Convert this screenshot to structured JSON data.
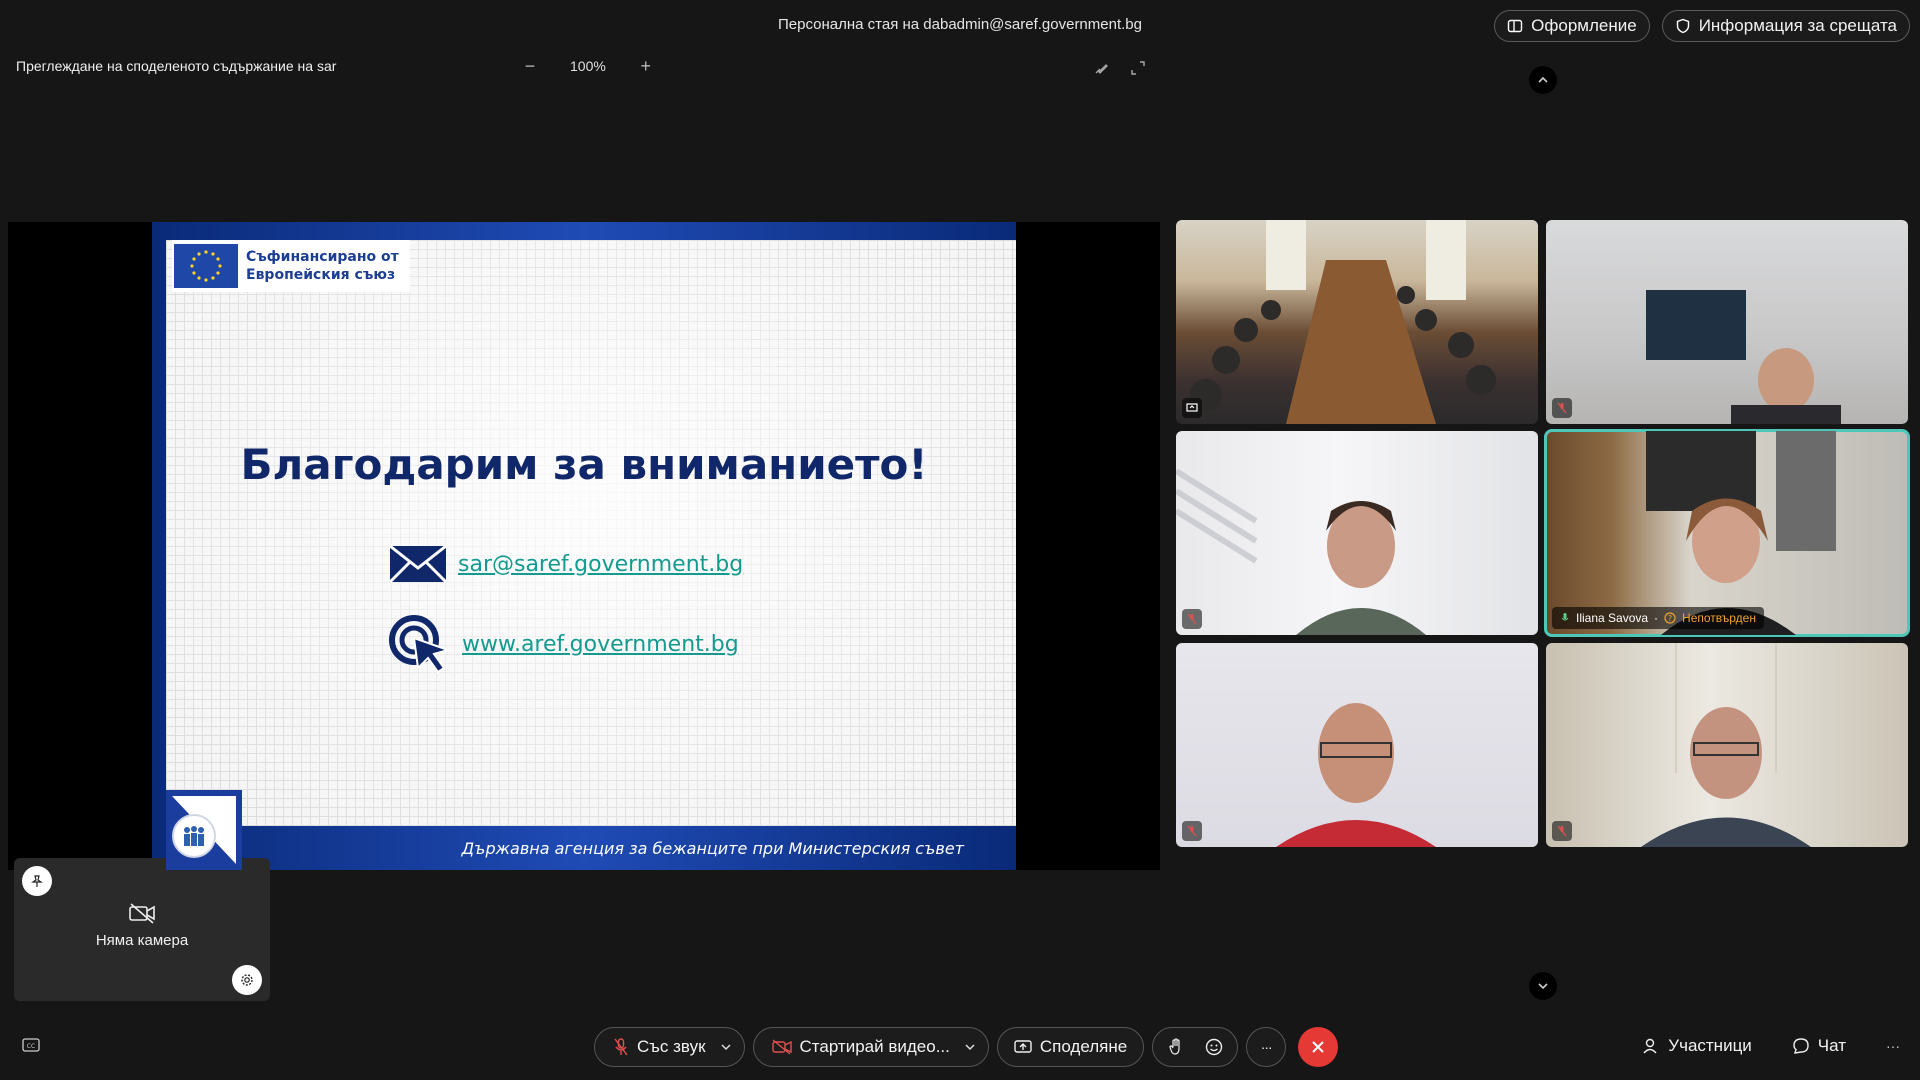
{
  "window": {
    "room_title": "Персонална стая на dabadmin@saref.government.bg"
  },
  "top_buttons": {
    "layout_label": "Оформление",
    "meeting_info_label": "Информация за срещата"
  },
  "share_bar": {
    "viewing_label": "Преглеждане на споделеното съдържание на sar",
    "zoom_level": "100%",
    "zoom_out_symbol": "−",
    "zoom_in_symbol": "+"
  },
  "slide": {
    "eu_line1": "Съфинансирано от",
    "eu_line2": "Европейския съюз",
    "title": "Благодарим за вниманието!",
    "email": "sar@saref.government.bg",
    "website": "www.aref.government.bg",
    "footer": "Държавна агенция за бежанците при Министерския съвет"
  },
  "participants": [
    {
      "tile": "conference-room",
      "icon": "screen-share-icon"
    },
    {
      "tile": "participant-2",
      "icon": "mic-muted-icon"
    },
    {
      "tile": "participant-3",
      "icon": "mic-muted-icon"
    },
    {
      "tile": "participant-4",
      "name": "Iliana Savova",
      "status": "Непотвърден",
      "icon": "mic-on-icon",
      "active": true
    },
    {
      "tile": "participant-5",
      "icon": "mic-muted-icon"
    },
    {
      "tile": "participant-6",
      "icon": "mic-muted-icon"
    }
  ],
  "self_view": {
    "no_camera_label": "Няма камера"
  },
  "controls": {
    "audio_label": "Със звук",
    "video_label": "Стартирай видео...",
    "share_label": "Споделяне",
    "participants_label": "Участници",
    "chat_label": "Чат",
    "more_symbol": "···"
  },
  "colors": {
    "end_call": "#e53935",
    "active_speaker": "#4fc7b8",
    "link": "#149a8f",
    "slide_blue": "#10286a"
  }
}
